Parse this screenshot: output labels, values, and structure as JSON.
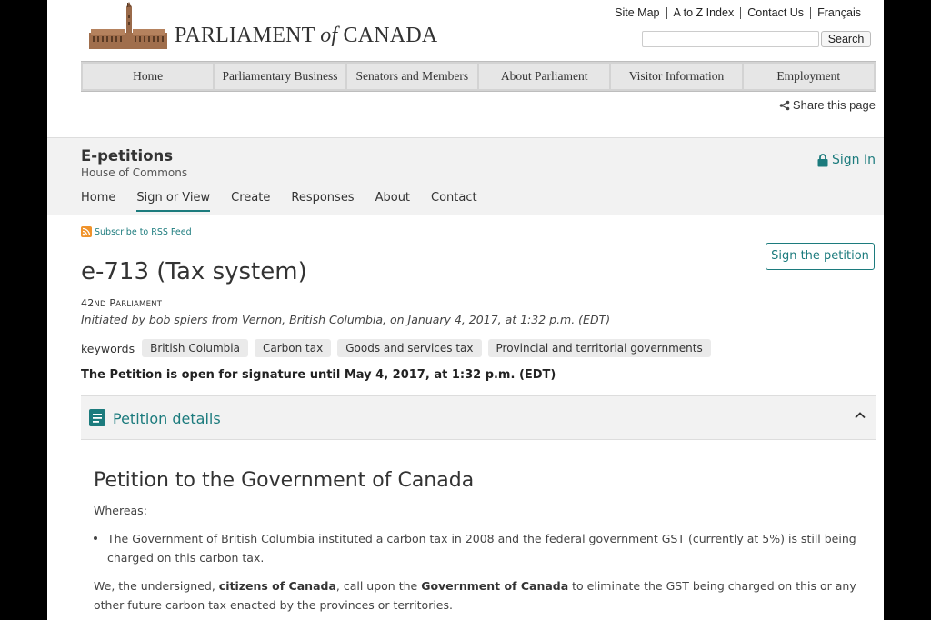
{
  "header": {
    "logo_text_a": "PARLIAMENT ",
    "logo_text_b": "of",
    "logo_text_c": " CANADA",
    "top_links": [
      "Site Map",
      "A to Z Index",
      "Contact Us",
      "Français"
    ],
    "search_button": "Search",
    "search_value": ""
  },
  "main_nav": [
    "Home",
    "Parliamentary Business",
    "Senators and Members",
    "About Parliament",
    "Visitor Information",
    "Employment"
  ],
  "share_label": "Share this page",
  "epetitions": {
    "title": "E-petitions",
    "subtitle": "House of Commons",
    "sign_in": "Sign In",
    "nav": [
      "Home",
      "Sign or View",
      "Create",
      "Responses",
      "About",
      "Contact"
    ],
    "active_nav": "Sign or View"
  },
  "rss_label": "Subscribe to RSS Feed",
  "sign_button": "Sign the petition",
  "petition": {
    "title": "e-713 (Tax system)",
    "parliament_num": "42",
    "parliament_suffix": "ND",
    "parliament_word": "P",
    "parliament_rest": "ARLIAMENT",
    "initiated": "Initiated by bob spiers from Vernon, British Columbia, on January 4, 2017, at 1:32 p.m. (EDT)",
    "keywords_label": "keywords",
    "keywords": [
      "British Columbia",
      "Carbon tax",
      "Goods and services tax",
      "Provincial and territorial governments"
    ],
    "open_until": "The Petition is open for signature until May 4, 2017, at 1:32 p.m. (EDT)"
  },
  "details": {
    "label": "Petition details",
    "heading": "Petition to the Government of Canada",
    "whereas": "Whereas:",
    "bullet": "The Government of British Columbia instituted a carbon tax in 2008 and the federal government GST (currently at 5%) is still being charged on this carbon tax.",
    "we_1": "We, the undersigned, ",
    "we_2": "citizens of Canada",
    "we_3": ", call upon the ",
    "we_4": "Government of Canada",
    "we_5": " to eliminate the GST being charged on this or any other future carbon tax enacted by the provinces or territories."
  },
  "colors": {
    "accent": "#1c7b7d",
    "rss": "#f0932b",
    "band": "#f2f2f2"
  },
  "icons": [
    "parliament-building-logo",
    "share-icon",
    "lock-icon",
    "rss-icon",
    "document-icon",
    "chevron-up-icon"
  ]
}
